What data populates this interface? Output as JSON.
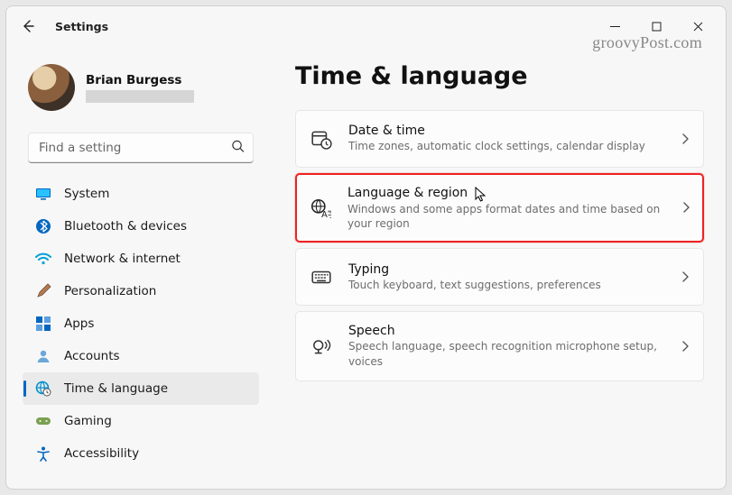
{
  "window": {
    "title": "Settings",
    "watermark": "groovyPost.com"
  },
  "profile": {
    "name": "Brian Burgess"
  },
  "search": {
    "placeholder": "Find a setting"
  },
  "sidebar": {
    "items": [
      {
        "label": "System",
        "icon": "system"
      },
      {
        "label": "Bluetooth & devices",
        "icon": "bluetooth"
      },
      {
        "label": "Network & internet",
        "icon": "wifi"
      },
      {
        "label": "Personalization",
        "icon": "brush"
      },
      {
        "label": "Apps",
        "icon": "apps"
      },
      {
        "label": "Accounts",
        "icon": "person"
      },
      {
        "label": "Time & language",
        "icon": "globe-clock",
        "active": true
      },
      {
        "label": "Gaming",
        "icon": "gaming"
      },
      {
        "label": "Accessibility",
        "icon": "accessibility"
      }
    ]
  },
  "page": {
    "title": "Time & language",
    "cards": [
      {
        "icon": "calendar-clock",
        "title": "Date & time",
        "subtitle": "Time zones, automatic clock settings, calendar display"
      },
      {
        "icon": "globe-lang",
        "title": "Language & region",
        "subtitle": "Windows and some apps format dates and time based on your region",
        "highlight": true,
        "cursor": true
      },
      {
        "icon": "keyboard",
        "title": "Typing",
        "subtitle": "Touch keyboard, text suggestions, preferences"
      },
      {
        "icon": "speech",
        "title": "Speech",
        "subtitle": "Speech language, speech recognition microphone setup, voices"
      }
    ]
  }
}
